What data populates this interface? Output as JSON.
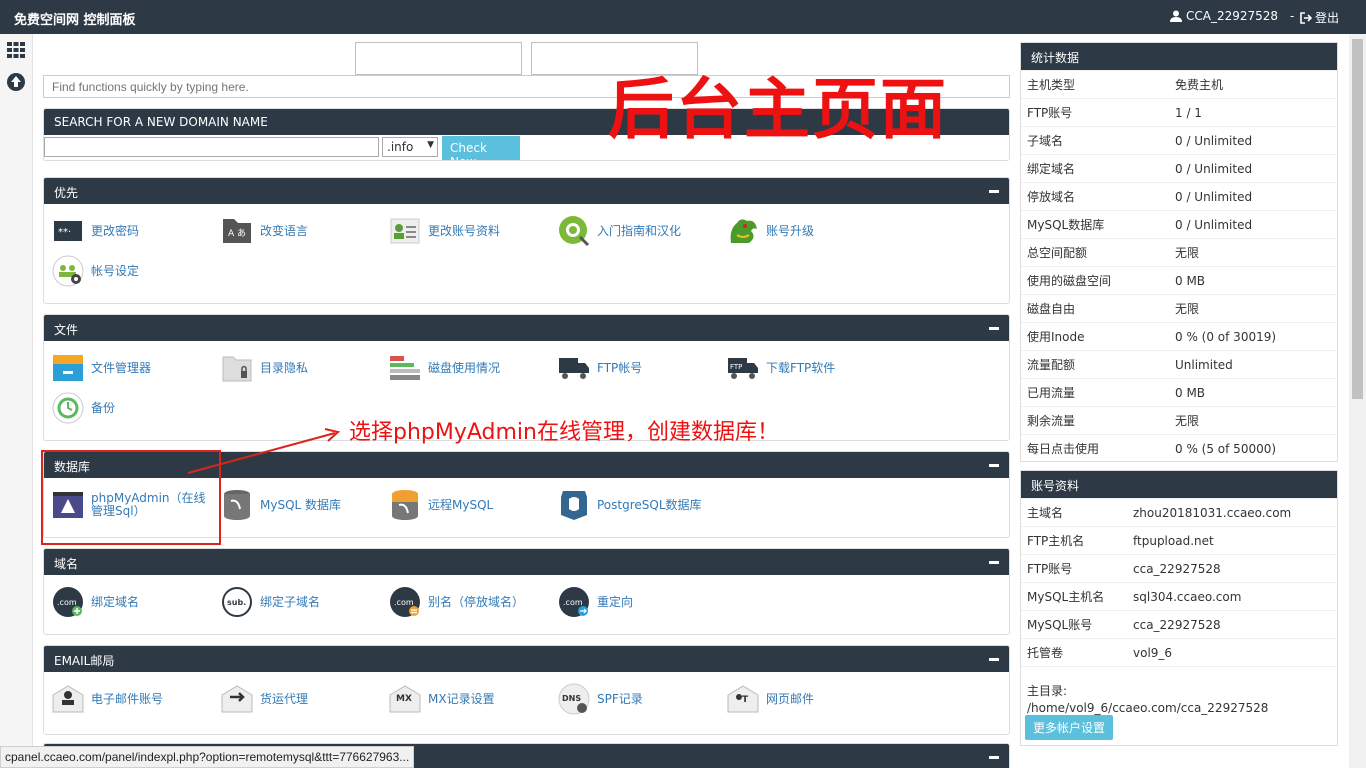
{
  "topbar": {
    "brand": "免费空间网 控制面板",
    "user": "CCA_22927528",
    "user_caret": "-",
    "logout": "登出"
  },
  "search": {
    "placeholder": "Find functions quickly by typing here."
  },
  "domain_search": {
    "title": "SEARCH FOR A NEW DOMAIN NAME",
    "tld": ".info",
    "button": "Check Now"
  },
  "sections": [
    {
      "title": "优先",
      "items": [
        "更改密码",
        "改变语言",
        "更改账号资料",
        "入门指南和汉化",
        "账号升级",
        "帐号设定"
      ]
    },
    {
      "title": "文件",
      "items": [
        "文件管理器",
        "目录隐私",
        "磁盘使用情况",
        "FTP帐号",
        "下载FTP软件",
        "备份"
      ]
    },
    {
      "title": "数据库",
      "items": [
        "phpMyAdmin（在线管理Sql）",
        "MySQL 数据库",
        "远程MySQL",
        "PostgreSQL数据库"
      ]
    },
    {
      "title": "域名",
      "items": [
        "绑定域名",
        "绑定子域名",
        "别名（停放域名）",
        "重定向"
      ]
    },
    {
      "title": "EMAIL邮局",
      "items": [
        "电子邮件账号",
        "货运代理",
        "MX记录设置",
        "SPF记录",
        "网页邮件"
      ]
    }
  ],
  "annotations": {
    "title": "后台主页面",
    "note": "选择phpMyAdmin在线管理，创建数据库！"
  },
  "stats": {
    "title": "统计数据",
    "rows": [
      [
        "主机类型",
        "免费主机"
      ],
      [
        "FTP账号",
        "1 / 1"
      ],
      [
        "子域名",
        "0 / Unlimited"
      ],
      [
        "绑定域名",
        "0 / Unlimited"
      ],
      [
        "停放域名",
        "0 / Unlimited"
      ],
      [
        "MySQL数据库",
        "0 / Unlimited"
      ],
      [
        "总空间配额",
        "无限"
      ],
      [
        "使用的磁盘空间",
        "0 MB"
      ],
      [
        "磁盘自由",
        "无限"
      ],
      [
        "使用Inode",
        "0 % (0 of 30019)"
      ],
      [
        "流量配额",
        "Unlimited"
      ],
      [
        "已用流量",
        "0 MB"
      ],
      [
        "剩余流量",
        "无限"
      ],
      [
        "每日点击使用",
        "0 % (5 of 50000)"
      ]
    ]
  },
  "account": {
    "title": "账号资料",
    "rows": [
      [
        "主域名",
        "zhou20181031.ccaeo.com"
      ],
      [
        "FTP主机名",
        "ftpupload.net"
      ],
      [
        "FTP账号",
        "cca_22927528"
      ],
      [
        "MySQL主机名",
        "sql304.ccaeo.com"
      ],
      [
        "MySQL账号",
        "cca_22927528"
      ],
      [
        "托管卷",
        "vol9_6"
      ]
    ],
    "home_label": "主目录:",
    "home_path": "/home/vol9_6/ccaeo.com/cca_22927528",
    "more_button": "更多帐户设置"
  },
  "status_url": "cpanel.ccaeo.com/panel/indexpl.php?option=remotemysql&ttt=776627963..."
}
